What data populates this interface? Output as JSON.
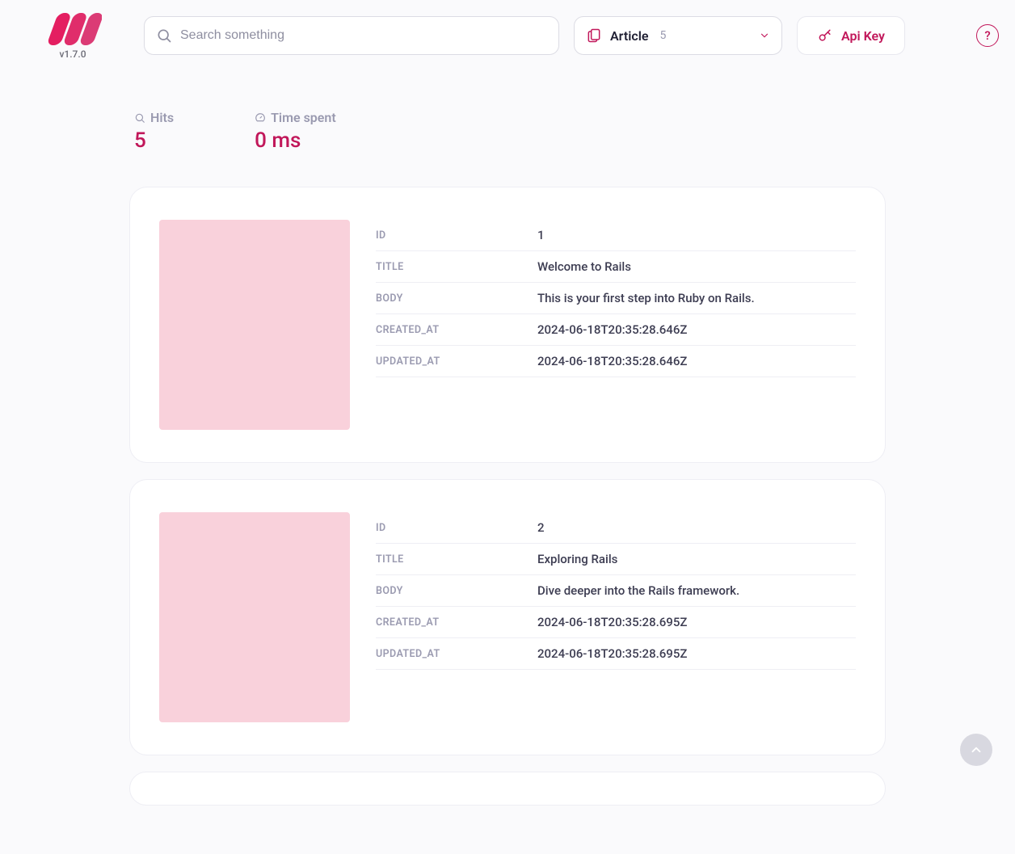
{
  "app": {
    "version": "v1.7.0"
  },
  "header": {
    "search_placeholder": "Search something",
    "index_name": "Article",
    "index_count": "5",
    "api_key_label": "Api Key",
    "help_label": "?"
  },
  "stats": {
    "hits_label": "Hits",
    "hits_value": "5",
    "time_label": "Time spent",
    "time_value": "0 ms"
  },
  "field_labels": {
    "id": "ID",
    "title": "TITLE",
    "body": "BODY",
    "created_at": "CREATED_AT",
    "updated_at": "UPDATED_AT"
  },
  "results": [
    {
      "id": "1",
      "title": "Welcome to Rails",
      "body": "This is your first step into Ruby on Rails.",
      "created_at": "2024-06-18T20:35:28.646Z",
      "updated_at": "2024-06-18T20:35:28.646Z"
    },
    {
      "id": "2",
      "title": "Exploring Rails",
      "body": "Dive deeper into the Rails framework.",
      "created_at": "2024-06-18T20:35:28.695Z",
      "updated_at": "2024-06-18T20:35:28.695Z"
    }
  ]
}
